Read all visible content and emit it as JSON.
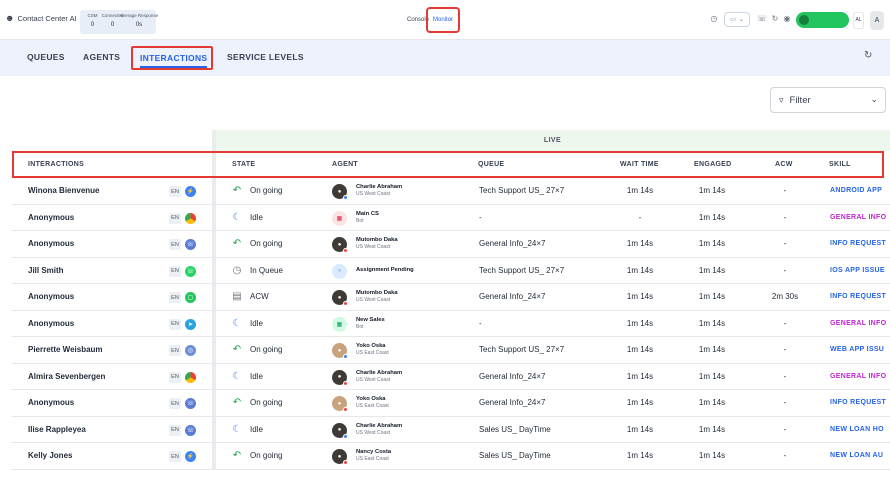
{
  "header": {
    "app_title": "Contact Center AI",
    "stats": [
      {
        "label": "CSM",
        "value": "0"
      },
      {
        "label": "Connected",
        "value": "0"
      },
      {
        "label": "Average Response",
        "value": "0s"
      }
    ],
    "mode_console": "Console",
    "mode_monitor": "Monitor",
    "lang_initial": "AL",
    "avatar_initial": "A",
    "status_color": "#22c55e"
  },
  "tabs": [
    {
      "label": "QUEUES"
    },
    {
      "label": "AGENTS"
    },
    {
      "label": "INTERACTIONS",
      "active": true
    },
    {
      "label": "SERVICE LEVELS"
    }
  ],
  "filter": {
    "label": "Filter"
  },
  "table": {
    "live_label": "LIVE",
    "columns": {
      "interactions": "INTERACTIONS",
      "state": "STATE",
      "agent": "AGENT",
      "queue": "QUEUE",
      "wait_time": "WAIT TIME",
      "engaged": "ENGAGED",
      "acw": "ACW",
      "skill": "SKILL"
    },
    "rows": [
      {
        "name": "Winona Bienvenue",
        "lang": "EN",
        "channel": "messenger",
        "state_icon": "ongoing-icon",
        "state": "On going",
        "agent_name": "Charlie Abraham",
        "agent_loc": "US West Coast",
        "agent_icon": "person-avatar",
        "queue": "Tech Support US_ 27×7",
        "wait": "1m 14s",
        "engaged": "1m 14s",
        "acw": "-",
        "skill": "ANDROID  APP",
        "skill_color": "#2563eb"
      },
      {
        "name": "Anonymous",
        "lang": "EN",
        "channel": "chrome",
        "state_icon": "idle-icon",
        "state": "Idle",
        "agent_name": "Main CS",
        "agent_loc": "Bot",
        "agent_icon": "bot-avatar",
        "queue": "-",
        "wait": "-",
        "engaged": "1m 14s",
        "acw": "-",
        "skill": "GENERAL INFO",
        "skill_color": "#c026d3"
      },
      {
        "name": "Anonymous",
        "lang": "EN",
        "channel": "phone",
        "state_icon": "ongoing-icon",
        "state": "On going",
        "agent_name": "Mutombo Daka",
        "agent_loc": "US West Coast",
        "agent_icon": "person-avatar",
        "queue": "General Info_24×7",
        "wait": "1m 14s",
        "engaged": "1m 14s",
        "acw": "-",
        "skill": "INFO REQUEST",
        "skill_color": "#2563eb"
      },
      {
        "name": "Jill Smith",
        "lang": "EN",
        "channel": "whatsapp",
        "state_icon": "clock-icon",
        "state": "In Queue",
        "agent_name": "Assignment Pending",
        "agent_loc": "",
        "agent_icon": "pending-avatar",
        "queue": "Tech Support US_ 27×7",
        "wait": "1m 14s",
        "engaged": "1m 14s",
        "acw": "-",
        "skill": "IOS  APP ISSUE",
        "skill_color": "#2563eb"
      },
      {
        "name": "Anonymous",
        "lang": "EN",
        "channel": "sms",
        "state_icon": "acw-icon",
        "state": "ACW",
        "agent_name": "Mutombo Daka",
        "agent_loc": "US West Coast",
        "agent_icon": "person-avatar",
        "queue": "General Info_24×7",
        "wait": "1m 14s",
        "engaged": "1m 14s",
        "acw": "2m 30s",
        "skill": "INFO REQUEST",
        "skill_color": "#2563eb"
      },
      {
        "name": "Anonymous",
        "lang": "EN",
        "channel": "telegram",
        "state_icon": "idle-icon",
        "state": "Idle",
        "agent_name": "New Sales",
        "agent_loc": "Bot",
        "agent_icon": "bot-avatar",
        "queue": "-",
        "wait": "1m 14s",
        "engaged": "1m 14s",
        "acw": "-",
        "skill": "GENERAL INFO",
        "skill_color": "#c026d3"
      },
      {
        "name": "Pierrette Weisbaum",
        "lang": "EN",
        "channel": "web",
        "state_icon": "ongoing-icon",
        "state": "On going",
        "agent_name": "Yoko Oska",
        "agent_loc": "US East Coast",
        "agent_icon": "person-avatar",
        "queue": "Tech Support US_ 27×7",
        "wait": "1m 14s",
        "engaged": "1m 14s",
        "acw": "-",
        "skill": "WEB  APP ISSU",
        "skill_color": "#2563eb"
      },
      {
        "name": "Almira Sevenbergen",
        "lang": "EN",
        "channel": "chrome",
        "state_icon": "idle-icon",
        "state": "Idle",
        "agent_name": "Charlie Abraham",
        "agent_loc": "US West Coast",
        "agent_icon": "person-avatar",
        "queue": "General Info_24×7",
        "wait": "1m 14s",
        "engaged": "1m 14s",
        "acw": "-",
        "skill": "GENERAL INFO",
        "skill_color": "#c026d3"
      },
      {
        "name": "Anonymous",
        "lang": "EN",
        "channel": "phone",
        "state_icon": "ongoing-icon",
        "state": "On going",
        "agent_name": "Yoko Oska",
        "agent_loc": "US East Coast",
        "agent_icon": "person-avatar",
        "queue": "General Info_24×7",
        "wait": "1m 14s",
        "engaged": "1m 14s",
        "acw": "-",
        "skill": "INFO REQUEST",
        "skill_color": "#2563eb"
      },
      {
        "name": "Ilise Rappleyea",
        "lang": "EN",
        "channel": "phone",
        "state_icon": "idle-icon",
        "state": "Idle",
        "agent_name": "Charlie Abraham",
        "agent_loc": "US West Coast",
        "agent_icon": "person-avatar",
        "queue": "Sales US_ DayTime",
        "wait": "1m 14s",
        "engaged": "1m 14s",
        "acw": "-",
        "skill": "NEW LOAN  HO",
        "skill_color": "#2563eb"
      },
      {
        "name": "Kelly Jones",
        "lang": "EN",
        "channel": "messenger",
        "state_icon": "ongoing-icon",
        "state": "On going",
        "agent_name": "Nancy Costa",
        "agent_loc": "US East Coast",
        "agent_icon": "person-avatar",
        "queue": "Sales US_ DayTime",
        "wait": "1m 14s",
        "engaged": "1m 14s",
        "acw": "-",
        "skill": "NEW LOAN  AU",
        "skill_color": "#2563eb"
      }
    ]
  }
}
